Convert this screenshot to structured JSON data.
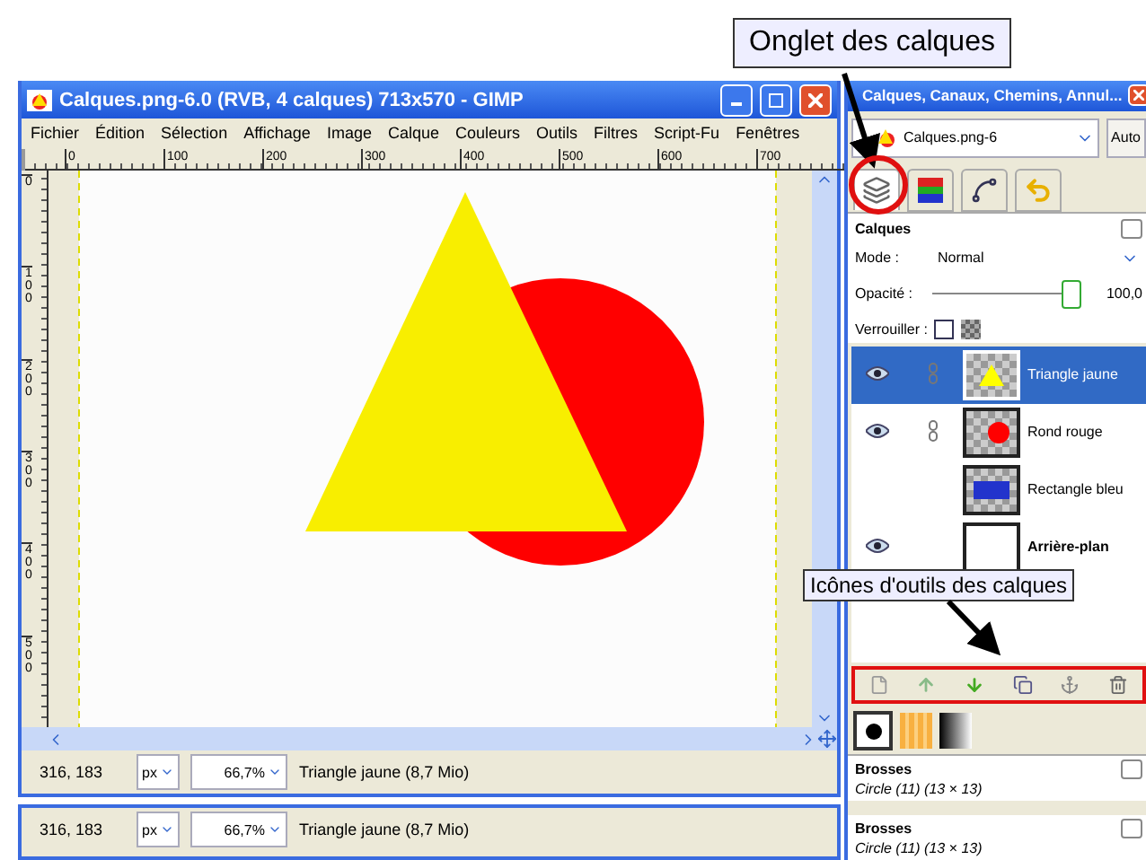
{
  "annotations": [
    {
      "kind": "tab",
      "text": "Onglet des calques"
    },
    {
      "kind": "tools",
      "text": "Icônes d'outils des calques"
    }
  ],
  "image_window": {
    "title": "Calques.png-6.0 (RVB, 4 calques) 713x570 - GIMP",
    "menu": [
      "Fichier",
      "Édition",
      "Sélection",
      "Affichage",
      "Image",
      "Calque",
      "Couleurs",
      "Outils",
      "Filtres",
      "Script-Fu",
      "Fenêtres"
    ],
    "hruler": [
      "0",
      "100",
      "200",
      "300",
      "400",
      "500",
      "600",
      "700"
    ],
    "vruler": [
      "0",
      "100",
      "200",
      "300",
      "400",
      "500"
    ],
    "status": {
      "coords": "316, 183",
      "unit": "px",
      "zoom": "66,7%",
      "info": "Triangle jaune (8,7 Mio)"
    }
  },
  "second_window_status": {
    "coords": "316, 183",
    "unit": "px",
    "zoom": "66,7%",
    "info": "Triangle jaune (8,7 Mio)"
  },
  "dock": {
    "title": "Calques, Canaux, Chemins, Annul...",
    "image_menu": "Calques.png-6",
    "auto_button": "Auto",
    "tabs": [
      {
        "kind": "layers",
        "selected": true
      },
      {
        "kind": "channels",
        "selected": false
      },
      {
        "kind": "paths",
        "selected": false
      },
      {
        "kind": "undo",
        "selected": false
      }
    ],
    "panel_title": "Calques",
    "mode_label": "Mode :",
    "mode": "Normal",
    "opacity_label": "Opacité :",
    "opacity": {
      "level": 1.0,
      "reading": "100,0"
    },
    "lock_label": "Verrouiller :",
    "lock_checked": false,
    "layers": [
      {
        "name": "Triangle jaune",
        "kind": "triangle",
        "visible": true,
        "linked": true,
        "selected": true
      },
      {
        "name": "Rond rouge",
        "kind": "circle",
        "visible": true,
        "linked": true,
        "selected": false
      },
      {
        "name": "Rectangle bleu",
        "kind": "rectangle",
        "visible": false,
        "linked": false,
        "selected": false
      },
      {
        "name": "Arrière-plan",
        "kind": "background",
        "visible": true,
        "linked": false,
        "selected": false
      }
    ],
    "brush_sections": [
      {
        "title": "Brosses",
        "brush": "Circle (11) (13 × 13)"
      },
      {
        "title": "Brosses",
        "brush": "Circle (11) (13 × 13)"
      }
    ]
  }
}
